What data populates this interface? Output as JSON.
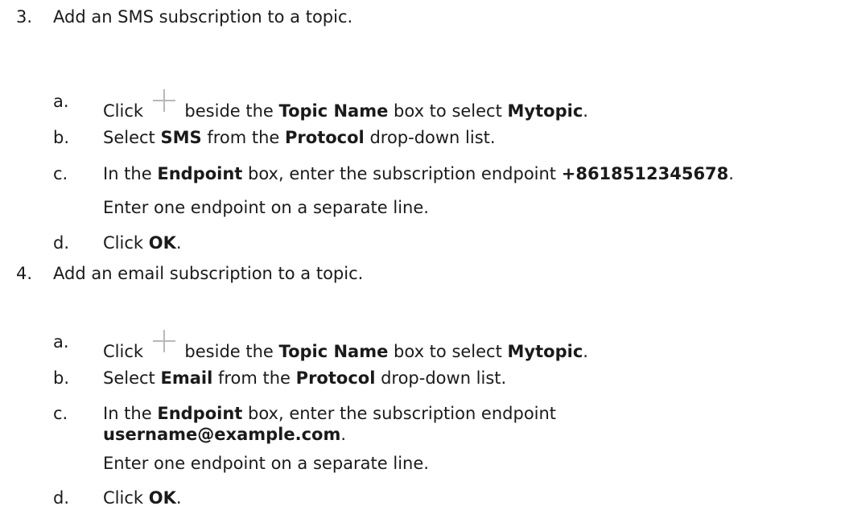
{
  "steps": [
    {
      "number": "3.",
      "text": "Add an SMS subscription to a topic.",
      "substeps": [
        {
          "letter": "a.",
          "parts": [
            "Click",
            "beside the",
            "Topic Name",
            "box to select",
            "Mytopic",
            "."
          ],
          "icon": "plus-icon"
        },
        {
          "letter": "b.",
          "parts": [
            "Select",
            "SMS",
            "from the",
            "Protocol",
            "drop-down list."
          ]
        },
        {
          "letter": "c.",
          "parts": [
            "In the",
            "Endpoint",
            "box, enter the subscription endpoint",
            "+8618512345678",
            "."
          ],
          "note": "Enter one endpoint on a separate line."
        },
        {
          "letter": "d.",
          "parts": [
            "Click",
            "OK",
            "."
          ]
        }
      ]
    },
    {
      "number": "4.",
      "text": "Add an email subscription to a topic.",
      "substeps": [
        {
          "letter": "a.",
          "parts": [
            "Click",
            "beside the",
            "Topic Name",
            "box to select",
            "Mytopic",
            "."
          ],
          "icon": "plus-icon"
        },
        {
          "letter": "b.",
          "parts": [
            "Select",
            "Email",
            "from the",
            "Protocol",
            "drop-down list."
          ]
        },
        {
          "letter": "c.",
          "parts": [
            "In the",
            "Endpoint",
            "box, enter the subscription endpoint",
            "username@example.com",
            "."
          ],
          "note": "Enter one endpoint on a separate line."
        },
        {
          "letter": "d.",
          "parts": [
            "Click",
            "OK",
            "."
          ]
        }
      ]
    }
  ]
}
